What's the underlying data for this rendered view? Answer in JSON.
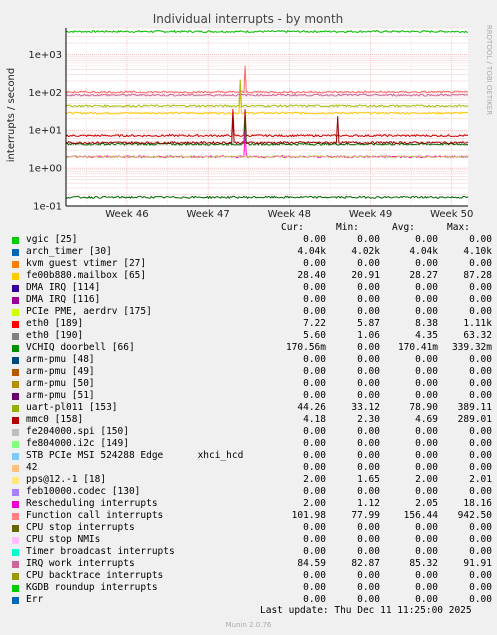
{
  "title": "Individual interrupts - by month",
  "ylabel": "interrupts / second",
  "side_text": "RRDTOOL / TOBI OETIKER",
  "footer": "Munin 2.0.76",
  "last_update": "Last update: Thu Dec 11 11:25:00 2025",
  "columns": [
    "Cur:",
    "Min:",
    "Avg:",
    "Max:"
  ],
  "chart_data": {
    "type": "line",
    "title": "Individual interrupts - by month",
    "ylabel": "interrupts / second",
    "yscale": "log",
    "ylim": [
      0.1,
      5000
    ],
    "yticks": [
      "1e-01",
      "1e+00",
      "1e+01",
      "1e+02",
      "1e+03"
    ],
    "ytick_values": [
      0.1,
      1,
      10,
      100,
      1000
    ],
    "xticks": [
      "Week 46",
      "Week 47",
      "Week 48",
      "Week 49",
      "Week 50"
    ],
    "xtick_positions": [
      1.0,
      2.0,
      3.0,
      4.0,
      5.0
    ],
    "xlim": [
      0.25,
      5.2
    ],
    "grid": true,
    "series": [
      {
        "name": "arch_timer [30]",
        "color": "#00c000",
        "level": 4040,
        "spike_at": []
      },
      {
        "name": "fe00b880.mailbox [65]",
        "color": "#ffcc00",
        "level": 28.3,
        "spike_at": [
          2.4
        ]
      },
      {
        "name": "eth0 [189]",
        "color": "#cc0000",
        "level": 7.2,
        "spike_at": [
          2.3,
          2.45
        ]
      },
      {
        "name": "eth0 [190]",
        "color": "#006600",
        "level": 4.3,
        "spike_at": [
          2.45
        ]
      },
      {
        "name": "uart-pl011 [153]",
        "color": "#a0bf00",
        "level": 44,
        "spike_at": [
          2.4
        ]
      },
      {
        "name": "mmc0 [158]",
        "color": "#990000",
        "level": 4.7,
        "spike_at": [
          2.3,
          3.6
        ]
      },
      {
        "name": "Rescheduling interrupts",
        "color": "#ff00cc",
        "level": 2.0,
        "spike_at": [
          2.45
        ]
      },
      {
        "name": "Function call interrupts",
        "color": "#ff6666",
        "level": 102,
        "spike_at": [
          2.45
        ]
      },
      {
        "name": "IRQ work interrupts",
        "color": "#cc6699",
        "level": 85,
        "spike_at": []
      },
      {
        "name": "pps@12.-1 [18]",
        "color": "#cccc66",
        "level": 2.0,
        "spike_at": []
      },
      {
        "name": "VCHIQ doorbell [66]",
        "color": "#006600",
        "level": 0.17,
        "spike_at": []
      }
    ]
  },
  "legend": [
    {
      "name": "vgic [25]",
      "color": "#00cc00",
      "cur": "0.00",
      "min": "0.00",
      "avg": "0.00",
      "max": "0.00"
    },
    {
      "name": "arch_timer [30]",
      "color": "#0066b3",
      "cur": "4.04k",
      "min": "4.02k",
      "avg": "4.04k",
      "max": "4.10k"
    },
    {
      "name": "kvm guest vtimer [27]",
      "color": "#ff8000",
      "cur": "0.00",
      "min": "0.00",
      "avg": "0.00",
      "max": "0.00"
    },
    {
      "name": "fe00b880.mailbox [65]",
      "color": "#ffcc00",
      "cur": "28.40",
      "min": "20.91",
      "avg": "28.27",
      "max": "87.28"
    },
    {
      "name": "DMA IRQ [114]",
      "color": "#330099",
      "cur": "0.00",
      "min": "0.00",
      "avg": "0.00",
      "max": "0.00"
    },
    {
      "name": "DMA IRQ [116]",
      "color": "#990099",
      "cur": "0.00",
      "min": "0.00",
      "avg": "0.00",
      "max": "0.00"
    },
    {
      "name": "PCIe PME, aerdrv [175]",
      "color": "#ccff00",
      "cur": "0.00",
      "min": "0.00",
      "avg": "0.00",
      "max": "0.00"
    },
    {
      "name": "eth0 [189]",
      "color": "#ff0000",
      "cur": "7.22",
      "min": "5.87",
      "avg": "8.38",
      "max": "1.11k"
    },
    {
      "name": "eth0 [190]",
      "color": "#808080",
      "cur": "5.60",
      "min": "1.06",
      "avg": "4.35",
      "max": "63.32"
    },
    {
      "name": "VCHIQ doorbell [66]",
      "color": "#008f00",
      "cur": "170.56m",
      "min": "0.00",
      "avg": "170.41m",
      "max": "339.32m"
    },
    {
      "name": "arm-pmu [48]",
      "color": "#00487d",
      "cur": "0.00",
      "min": "0.00",
      "avg": "0.00",
      "max": "0.00"
    },
    {
      "name": "arm-pmu [49]",
      "color": "#b35a00",
      "cur": "0.00",
      "min": "0.00",
      "avg": "0.00",
      "max": "0.00"
    },
    {
      "name": "arm-pmu [50]",
      "color": "#b38f00",
      "cur": "0.00",
      "min": "0.00",
      "avg": "0.00",
      "max": "0.00"
    },
    {
      "name": "arm-pmu [51]",
      "color": "#6b006b",
      "cur": "0.00",
      "min": "0.00",
      "avg": "0.00",
      "max": "0.00"
    },
    {
      "name": "uart-pl011 [153]",
      "color": "#8fb300",
      "cur": "44.26",
      "min": "33.12",
      "avg": "78.90",
      "max": "389.11"
    },
    {
      "name": "mmc0 [158]",
      "color": "#b30000",
      "cur": "4.18",
      "min": "2.30",
      "avg": "4.69",
      "max": "289.01"
    },
    {
      "name": "fe204000.spi [150]",
      "color": "#bebebe",
      "cur": "0.00",
      "min": "0.00",
      "avg": "0.00",
      "max": "0.00"
    },
    {
      "name": "fe804000.i2c [149]",
      "color": "#80ff80",
      "cur": "0.00",
      "min": "0.00",
      "avg": "0.00",
      "max": "0.00"
    },
    {
      "name": "STB PCIe MSI 524288 Edge      xhci_hcd",
      "color": "#80c9ff",
      "cur": "0.00",
      "min": "0.00",
      "avg": "0.00",
      "max": "0.00"
    },
    {
      "name": "42",
      "color": "#ffc080",
      "cur": "0.00",
      "min": "0.00",
      "avg": "0.00",
      "max": "0.00"
    },
    {
      "name": "pps@12.-1 [18]",
      "color": "#ffe680",
      "cur": "2.00",
      "min": "1.65",
      "avg": "2.00",
      "max": "2.01"
    },
    {
      "name": "feb10000.codec [130]",
      "color": "#aa80ff",
      "cur": "0.00",
      "min": "0.00",
      "avg": "0.00",
      "max": "0.00"
    },
    {
      "name": "Rescheduling interrupts",
      "color": "#ee00cc",
      "cur": "2.00",
      "min": "1.12",
      "avg": "2.05",
      "max": "18.16"
    },
    {
      "name": "Function call interrupts",
      "color": "#ff8080",
      "cur": "101.98",
      "min": "77.99",
      "avg": "156.44",
      "max": "942.50"
    },
    {
      "name": "CPU stop interrupts",
      "color": "#666600",
      "cur": "0.00",
      "min": "0.00",
      "avg": "0.00",
      "max": "0.00"
    },
    {
      "name": "CPU stop NMIs",
      "color": "#ffbfff",
      "cur": "0.00",
      "min": "0.00",
      "avg": "0.00",
      "max": "0.00"
    },
    {
      "name": "Timer broadcast interrupts",
      "color": "#00ffcc",
      "cur": "0.00",
      "min": "0.00",
      "avg": "0.00",
      "max": "0.00"
    },
    {
      "name": "IRQ work interrupts",
      "color": "#cc6699",
      "cur": "84.59",
      "min": "82.87",
      "avg": "85.32",
      "max": "91.91"
    },
    {
      "name": "CPU backtrace interrupts",
      "color": "#999900",
      "cur": "0.00",
      "min": "0.00",
      "avg": "0.00",
      "max": "0.00"
    },
    {
      "name": "KGDB roundup interrupts",
      "color": "#00cc00",
      "cur": "0.00",
      "min": "0.00",
      "avg": "0.00",
      "max": "0.00"
    },
    {
      "name": "Err",
      "color": "#0066b3",
      "cur": "0.00",
      "min": "0.00",
      "avg": "0.00",
      "max": "0.00"
    }
  ]
}
